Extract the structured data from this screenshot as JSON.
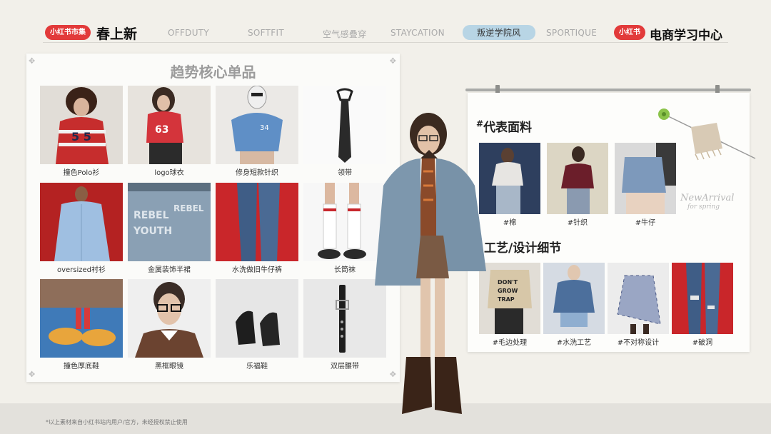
{
  "header": {
    "brand_badge": "小红书市集",
    "title": "春上新",
    "tabs": [
      {
        "label": "OFFDUTY"
      },
      {
        "label": "SOFTFIT"
      },
      {
        "label": "空气感叠穿"
      },
      {
        "label": "STAYCATION"
      },
      {
        "label": "叛逆学院风"
      },
      {
        "label": "SPORTIQUE"
      }
    ],
    "right_badge": "小红书",
    "right_title": "电商学习中心"
  },
  "core_items": {
    "title": "趋势核心单品",
    "items": [
      {
        "label": "撞色Polo衫"
      },
      {
        "label": "logo球衣"
      },
      {
        "label": "修身短款针织"
      },
      {
        "label": "领带"
      },
      {
        "label": "oversized衬衫"
      },
      {
        "label": "金属装饰半裙"
      },
      {
        "label": "水洗做旧牛仔裤"
      },
      {
        "label": "长筒袜"
      },
      {
        "label": "撞色厚底鞋"
      },
      {
        "label": "黑框眼镜"
      },
      {
        "label": "乐福鞋"
      },
      {
        "label": "双层腰带"
      }
    ]
  },
  "fabrics": {
    "hash": "#",
    "title": "代表面料",
    "items": [
      {
        "label": "#棉"
      },
      {
        "label": "#针织"
      },
      {
        "label": "#牛仔"
      }
    ]
  },
  "details": {
    "title": "工艺/设计细节",
    "items": [
      {
        "label": "#毛边处理"
      },
      {
        "label": "#水洗工艺"
      },
      {
        "label": "#不对称设计"
      },
      {
        "label": "#破洞"
      }
    ]
  },
  "decor": {
    "new_arrival": "NewArrival",
    "for_spring": "for spring"
  },
  "footnote": "*以上素材来自小红书站内用户/官方，未经授权禁止使用"
}
